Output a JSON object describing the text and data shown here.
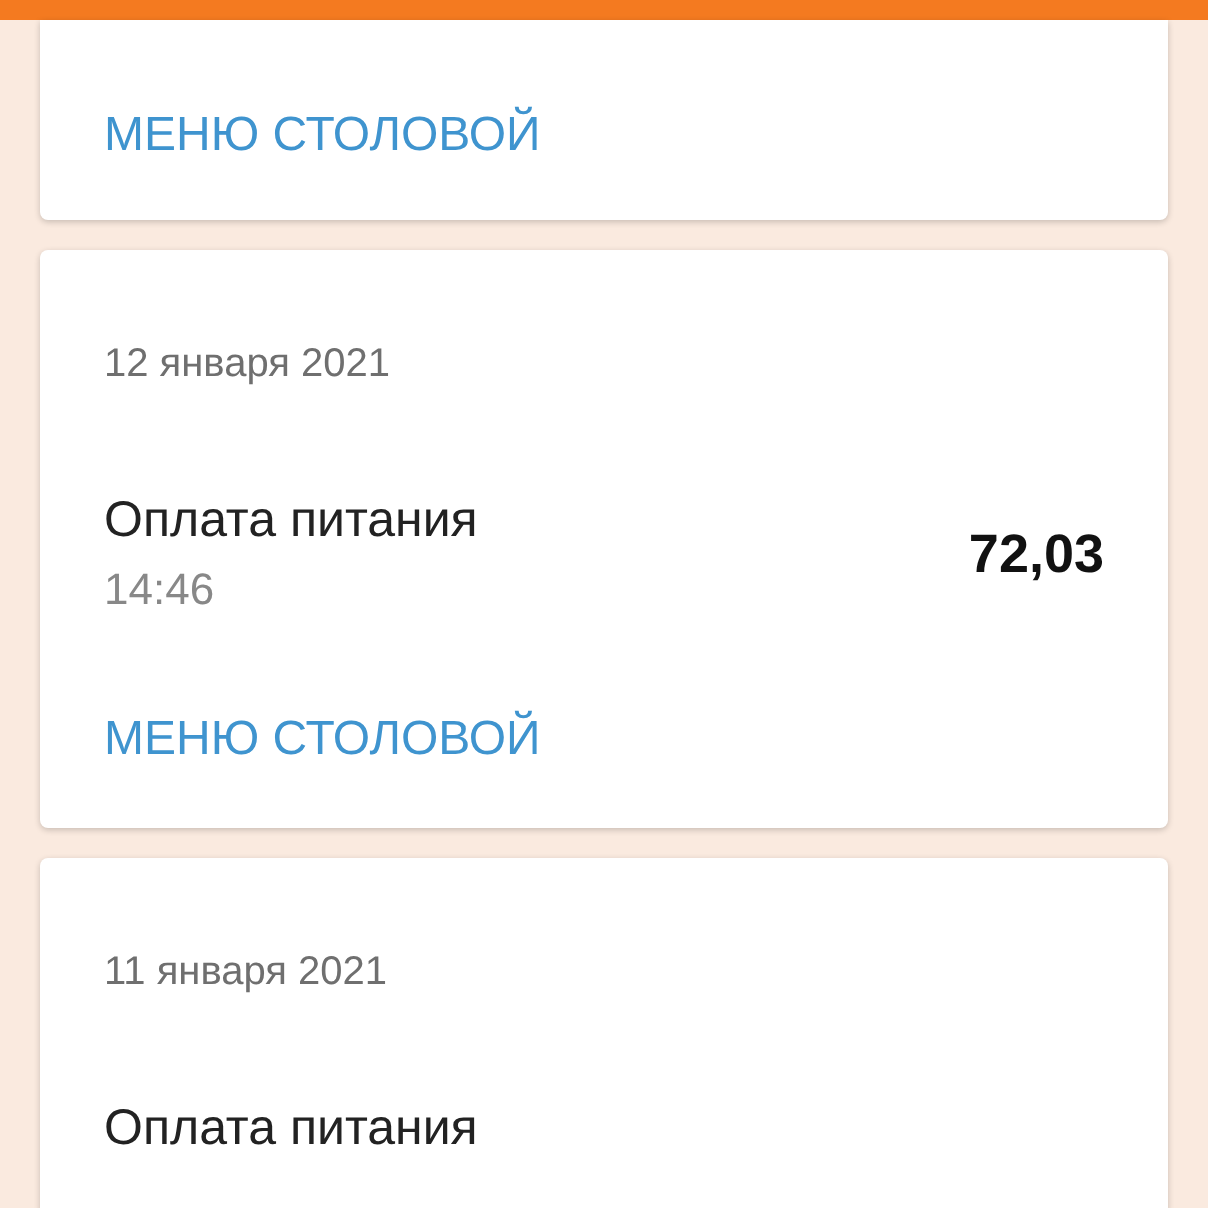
{
  "cards": [
    {
      "link": "МЕНЮ СТОЛОВОЙ"
    },
    {
      "date": "12 января 2021",
      "payment": {
        "title": "Оплата питания",
        "time": "14:46",
        "amount": "72,03"
      },
      "link": "МЕНЮ СТОЛОВОЙ"
    },
    {
      "date": "11 января 2021",
      "payment": {
        "title": "Оплата питания"
      }
    }
  ]
}
